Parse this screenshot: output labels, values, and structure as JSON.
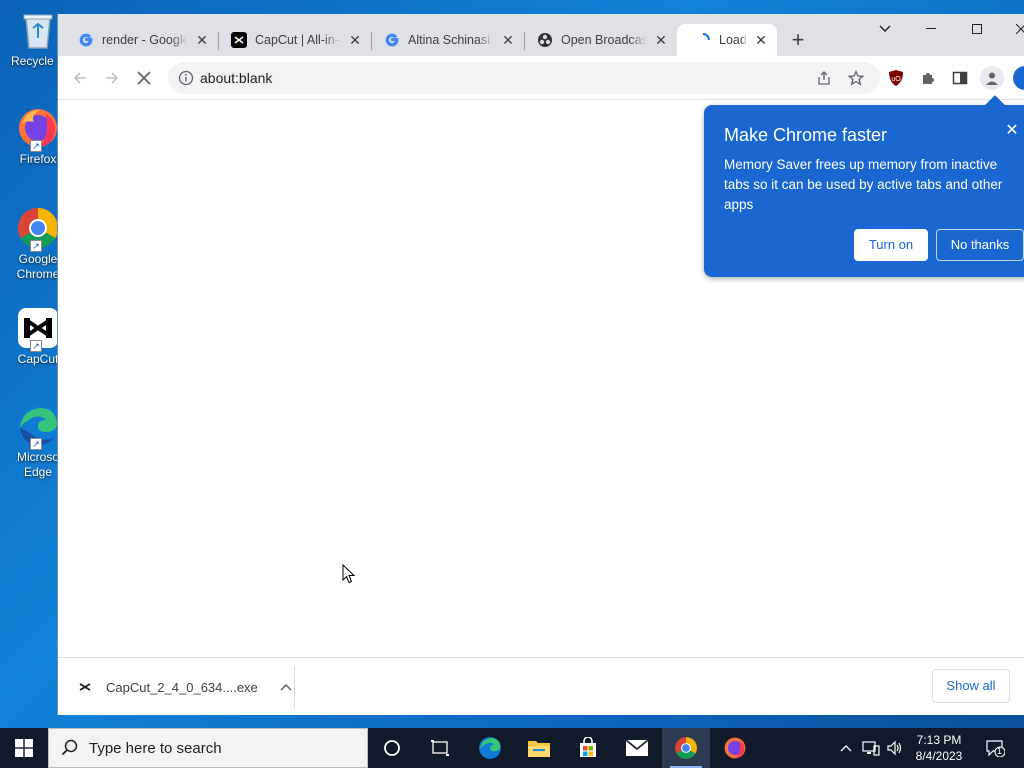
{
  "desktop": {
    "icons": [
      {
        "label": "Recycle Bin",
        "label_visible": "Recycle B"
      },
      {
        "label": "Firefox"
      },
      {
        "label": "Google Chrome",
        "line1": "Google",
        "line2": "Chrome"
      },
      {
        "label": "CapCut"
      },
      {
        "label": "Microsoft Edge",
        "line1": "Microso",
        "line2": "Edge"
      }
    ]
  },
  "browser": {
    "tabs": [
      {
        "title": "render - Google",
        "favicon": "google-icon"
      },
      {
        "title": "CapCut | All-in-on",
        "favicon": "capcut-icon"
      },
      {
        "title": "Altina Schinasi -",
        "favicon": "google-icon"
      },
      {
        "title": "Open Broadcaste",
        "favicon": "obs-icon"
      },
      {
        "title": "Loadin",
        "favicon": "loading-spinner-icon",
        "active": true
      }
    ],
    "address": {
      "url": "about:blank"
    },
    "accent": "#1a67d2"
  },
  "bubble": {
    "title": "Make Chrome faster",
    "body": "Memory Saver frees up memory from inactive tabs so it can be used by active tabs and other apps",
    "primary": "Turn on",
    "secondary": "No thanks"
  },
  "download_bar": {
    "filename": "CapCut_2_4_0_634....exe",
    "show_all": "Show all"
  },
  "taskbar": {
    "search_placeholder": "Type here to search",
    "time": "7:13 PM",
    "date": "8/4/2023",
    "notifications": "1"
  }
}
